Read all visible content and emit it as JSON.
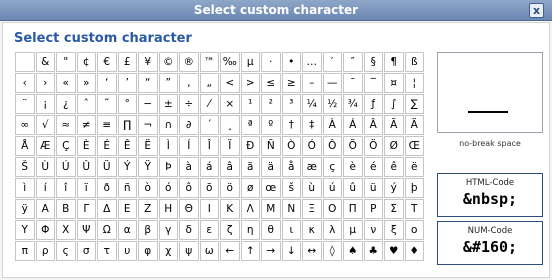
{
  "window": {
    "title": "Select custom character",
    "close_label": "x"
  },
  "heading": "Select custom character",
  "grid": [
    [
      "",
      "&",
      "\"",
      "¢",
      "€",
      "£",
      "¥",
      "©",
      "®",
      "™",
      "‰",
      "µ",
      "·",
      "•",
      "…",
      "′",
      "″",
      "§",
      "¶",
      "ß"
    ],
    [
      "‹",
      "›",
      "«",
      "»",
      "‘",
      "’",
      "“",
      "”",
      "‚",
      "„",
      "<",
      ">",
      "≤",
      "≥",
      "–",
      "—",
      "¯",
      "‾",
      "¤",
      "¦"
    ],
    [
      "¨",
      "¡",
      "¿",
      "ˆ",
      "˜",
      "°",
      "−",
      "±",
      "÷",
      "⁄",
      "×",
      "¹",
      "²",
      "³",
      "¼",
      "½",
      "¾",
      "ƒ",
      "∫",
      "∑"
    ],
    [
      "∞",
      "√",
      "≈",
      "≠",
      "≡",
      "∏",
      "¬",
      "∩",
      "∂",
      "´",
      "¸",
      "ª",
      "º",
      "†",
      "‡",
      "À",
      "Á",
      "Â",
      "Ã",
      "Ä"
    ],
    [
      "Å",
      "Æ",
      "Ç",
      "È",
      "É",
      "Ê",
      "Ë",
      "Ì",
      "Í",
      "Î",
      "Ï",
      "Ð",
      "Ñ",
      "Ò",
      "Ó",
      "Ô",
      "Õ",
      "Ö",
      "Ø",
      "Œ"
    ],
    [
      "Š",
      "Ù",
      "Ú",
      "Û",
      "Ü",
      "Ý",
      "Ÿ",
      "Þ",
      "à",
      "á",
      "â",
      "ã",
      "ä",
      "å",
      "æ",
      "ç",
      "è",
      "é",
      "ê",
      "ë"
    ],
    [
      "ì",
      "í",
      "î",
      "ï",
      "ð",
      "ñ",
      "ò",
      "ó",
      "ô",
      "õ",
      "ö",
      "ø",
      "œ",
      "š",
      "ù",
      "ú",
      "û",
      "ü",
      "ý",
      "þ"
    ],
    [
      "ÿ",
      "Α",
      "Β",
      "Γ",
      "Δ",
      "Ε",
      "Ζ",
      "Η",
      "Θ",
      "Ι",
      "Κ",
      "Λ",
      "Μ",
      "Ν",
      "Ξ",
      "Ο",
      "Π",
      "Ρ",
      "Σ",
      "Τ"
    ],
    [
      "Υ",
      "Φ",
      "Χ",
      "Ψ",
      "Ω",
      "α",
      "β",
      "γ",
      "δ",
      "ε",
      "ζ",
      "η",
      "θ",
      "ι",
      "κ",
      "λ",
      "μ",
      "ν",
      "ξ",
      "ο"
    ],
    [
      "π",
      "ρ",
      "ς",
      "σ",
      "τ",
      "υ",
      "φ",
      "χ",
      "ψ",
      "ω",
      "←",
      "↑",
      "→",
      "↓",
      "↔",
      "◊",
      "♠",
      "♣",
      "♥",
      "♦"
    ]
  ],
  "preview": {
    "name": "no-break space"
  },
  "html_code": {
    "label": "HTML-Code",
    "value": "&nbsp;"
  },
  "num_code": {
    "label": "NUM-Code",
    "value": "&#160;"
  }
}
